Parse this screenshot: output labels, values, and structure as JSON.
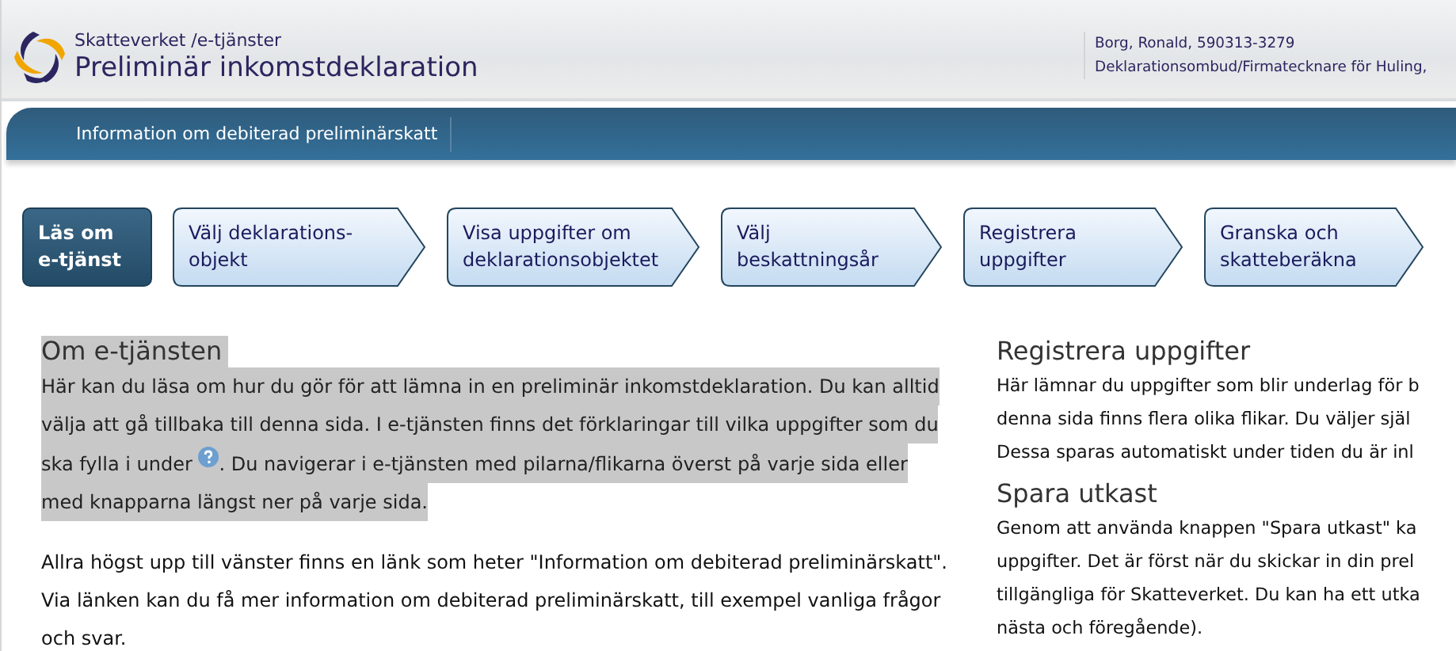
{
  "header": {
    "service": "Skatteverket /e-tjänster",
    "title": "Preliminär inkomstdeklaration",
    "user": "Borg, Ronald, 590313-3279",
    "role": "Deklarationsombud/Firmatecknare för Huling,"
  },
  "nav": {
    "links": [
      "Information om debiterad preliminärskatt"
    ]
  },
  "steps": [
    {
      "label": "Läs om e-tjänst",
      "selected": true
    },
    {
      "label": "Välj deklarations-objekt",
      "selected": false
    },
    {
      "label": "Visa uppgifter om deklarationsobjektet",
      "selected": false
    },
    {
      "label": "Välj beskattningsår",
      "selected": false
    },
    {
      "label": "Registrera uppgifter",
      "selected": false
    },
    {
      "label": "Granska och skatteberäkna",
      "selected": false
    }
  ],
  "left": {
    "heading": "Om e-tjänsten",
    "highlighted": true,
    "intro_lines": [
      {
        "text": "Här kan du läsa om hur du gör för att lämna in en preliminär inkomstdeklaration. Du kan alltid"
      },
      {
        "text": "välja att gå tillbaka till denna sida. I e-tjänsten finns det förklaringar till vilka uppgifter som du"
      },
      {
        "text": "ska fylla i under",
        "help_icon": true,
        "text_after": ". Du navigerar i e-tjänsten med pilarna/flikarna överst på varje sida eller"
      },
      {
        "text": "med knapparna längst ner på varje sida."
      }
    ],
    "paragraph_lines": [
      "Allra högst upp till vänster finns en länk som heter \"Information om debiterad preliminärskatt\".",
      "Via länken kan du få mer information om debiterad preliminärskatt, till exempel vanliga frågor",
      "och svar."
    ]
  },
  "right": {
    "sections": [
      {
        "heading": "Registrera uppgifter",
        "lines": [
          "Här lämnar du uppgifter som blir underlag för b",
          "denna sida finns flera olika flikar. Du väljer själ",
          "Dessa sparas automatiskt under tiden du är inl"
        ]
      },
      {
        "heading": "Spara utkast",
        "lines": [
          "Genom att använda knappen \"Spara utkast\" ka",
          "uppgifter. Det är först när du skickar in din prel",
          "tillgängliga för Skatteverket. Du kan ha ett utka",
          "nästa och föregående)."
        ]
      }
    ]
  }
}
